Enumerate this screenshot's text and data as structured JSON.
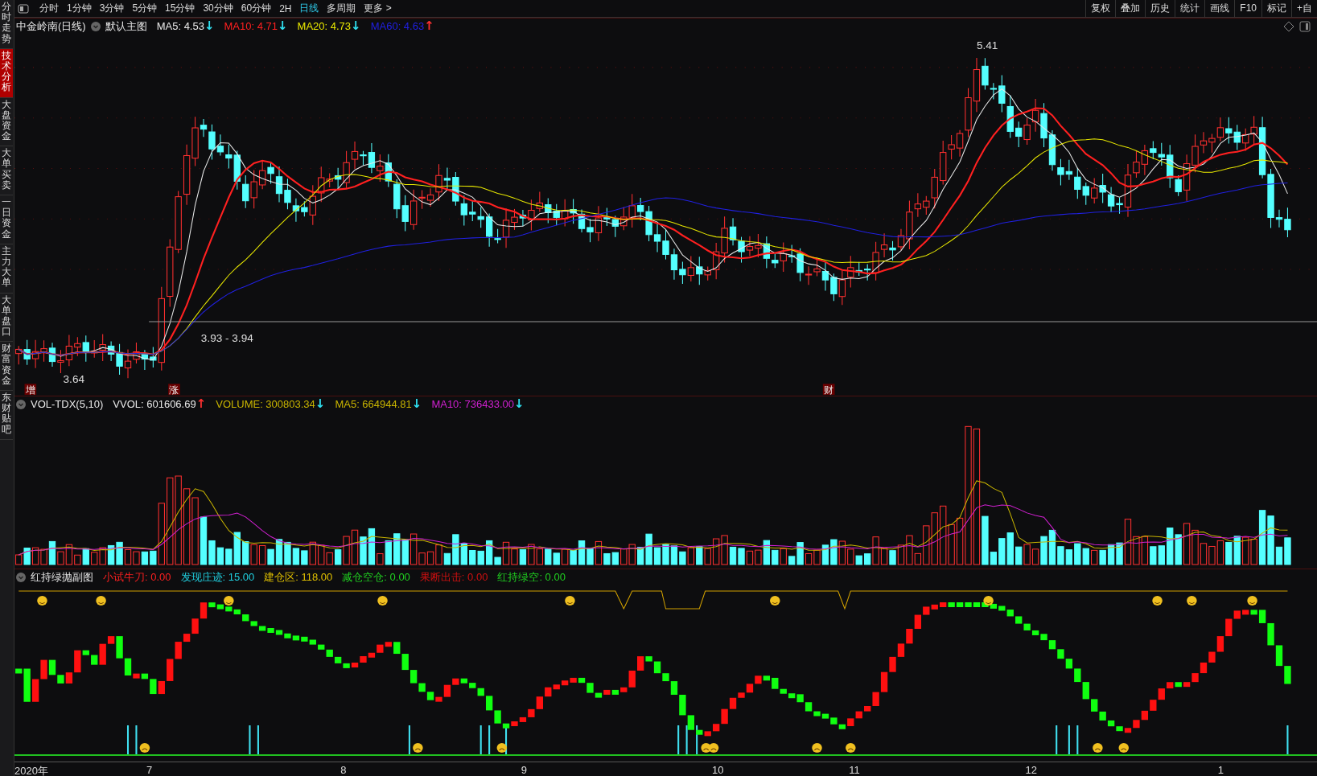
{
  "sidebar": {
    "items": [
      {
        "label": "分时走势",
        "selected": false
      },
      {
        "label": "技术分析",
        "selected": true
      },
      {
        "label": "大盘资金",
        "selected": false
      },
      {
        "label": "大单买卖",
        "selected": false
      },
      {
        "label": "一日资金",
        "selected": false
      },
      {
        "label": "主力大单",
        "selected": false
      },
      {
        "label": "大单盘口",
        "selected": false
      },
      {
        "label": "财富资金",
        "selected": false
      },
      {
        "label": "东财贴吧",
        "selected": false
      }
    ]
  },
  "period_tabs": [
    {
      "label": "分时",
      "selected": false
    },
    {
      "label": "1分钟",
      "selected": false
    },
    {
      "label": "3分钟",
      "selected": false
    },
    {
      "label": "5分钟",
      "selected": false
    },
    {
      "label": "15分钟",
      "selected": false
    },
    {
      "label": "30分钟",
      "selected": false
    },
    {
      "label": "60分钟",
      "selected": false
    },
    {
      "label": "2H",
      "selected": false
    },
    {
      "label": "日线",
      "selected": true
    },
    {
      "label": "多周期",
      "selected": false
    },
    {
      "label": "更多 >",
      "selected": false
    }
  ],
  "tools": [
    "复权",
    "叠加",
    "历史",
    "统计",
    "画线",
    "F10",
    "标记",
    "+自"
  ],
  "main_chart": {
    "title": "中金岭南(日线)",
    "template": "默认主图",
    "legend": [
      {
        "label": "MA5: 4.53",
        "color": "#e8e8e8",
        "arrow": {
          "text": "↓",
          "color": "#30e0f0"
        }
      },
      {
        "label": "MA10: 4.71",
        "color": "#ff2020",
        "arrow": {
          "text": "↓",
          "color": "#30e0f0"
        }
      },
      {
        "label": "MA20: 4.73",
        "color": "#e8e800",
        "arrow": {
          "text": "↓",
          "color": "#30e0f0"
        }
      },
      {
        "label": "MA60: 4.63",
        "color": "#2020e0",
        "arrow": {
          "text": "↑",
          "color": "#ff3030"
        }
      }
    ],
    "high_label": "5.41",
    "low_label": "3.64",
    "line_label": "3.93 - 3.94",
    "markers": [
      "增",
      "涨",
      "财"
    ]
  },
  "volume_chart": {
    "title": "VOL-TDX(5,10)",
    "legend": [
      {
        "label": "VVOL: 601606.69",
        "color": "#e8e8e8",
        "arrow": {
          "text": "↑",
          "color": "#ff3030"
        }
      },
      {
        "label": "VOLUME: 300803.34",
        "color": "#c8b400",
        "arrow": {
          "text": "↓",
          "color": "#30e0f0"
        }
      },
      {
        "label": "MA5: 664944.81",
        "color": "#c8b400",
        "arrow": {
          "text": "↓",
          "color": "#30e0f0"
        }
      },
      {
        "label": "MA10: 736433.00",
        "color": "#d020d0",
        "arrow": {
          "text": "↓",
          "color": "#30e0f0"
        }
      }
    ]
  },
  "indicator_chart": {
    "title": "红持绿抛副图",
    "legend": [
      {
        "label": "小试牛刀: 0.00",
        "color": "#ff2020"
      },
      {
        "label": "发现庄迹: 15.00",
        "color": "#20d0e0"
      },
      {
        "label": "建仓区: 118.00",
        "color": "#e0c000"
      },
      {
        "label": "减仓空仓: 0.00",
        "color": "#20d020"
      },
      {
        "label": "果断出击: 0.00",
        "color": "#d01010"
      },
      {
        "label": "红持绿空: 0.00",
        "color": "#20d020"
      }
    ]
  },
  "x_axis": [
    "2020年",
    "7",
    "8",
    "9",
    "10",
    "11",
    "12",
    "1"
  ]
}
